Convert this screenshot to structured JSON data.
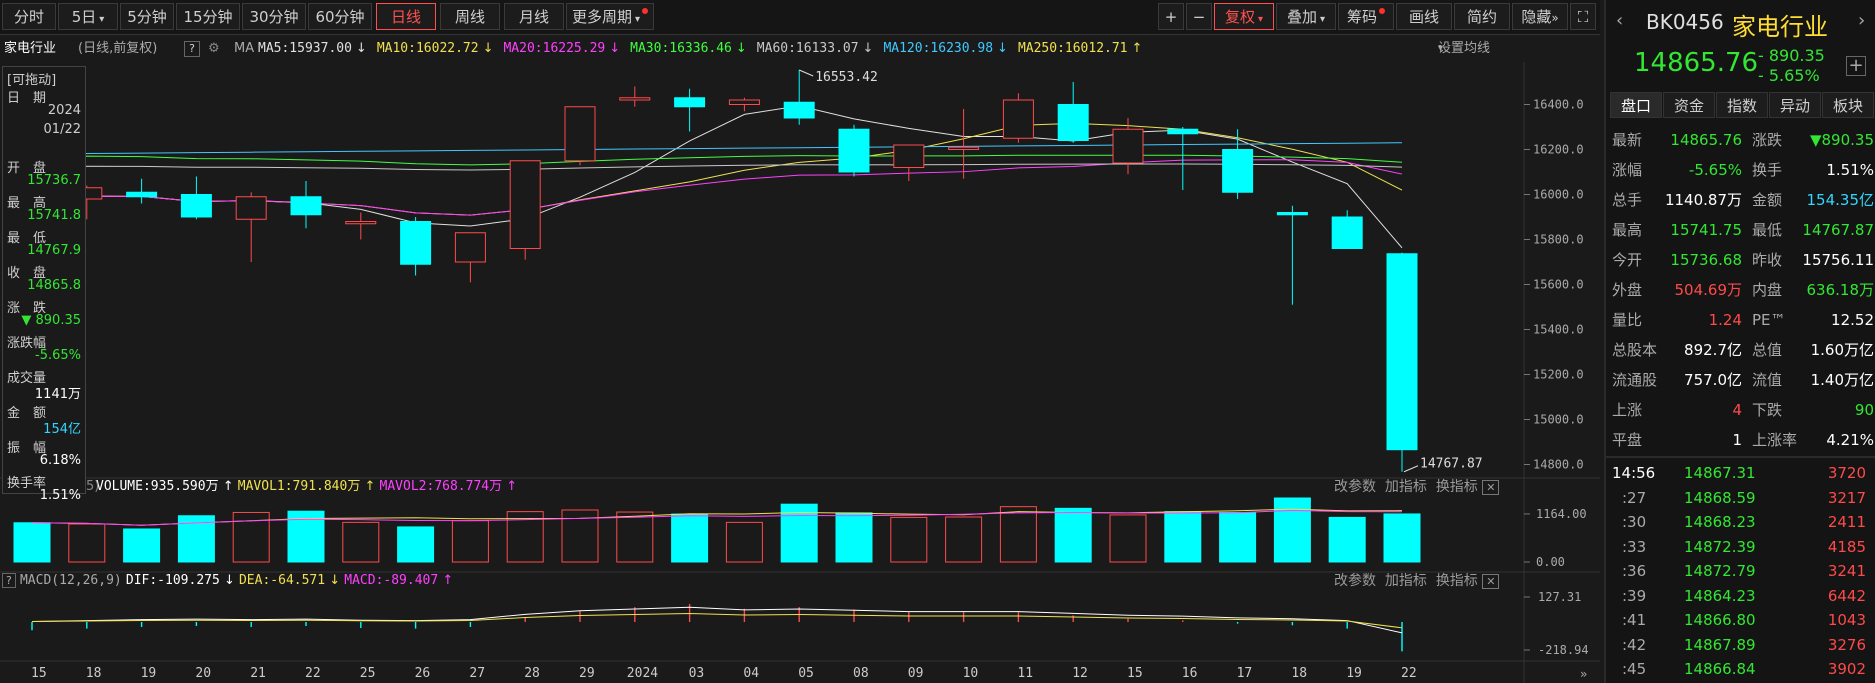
{
  "toolbar": {
    "periods": [
      "分时",
      "5日",
      "5分钟",
      "15分钟",
      "30分钟",
      "60分钟",
      "日线",
      "周线",
      "月线",
      "更多周期"
    ],
    "active_period": "日线",
    "right_buttons": [
      "复权",
      "叠加",
      "筹码",
      "画线",
      "简约",
      "隐藏"
    ],
    "plus": "+",
    "minus": "−",
    "fs": "⛶"
  },
  "ma_line": {
    "name": "家电行业",
    "mode": "(日线,前复权)",
    "q": "?",
    "ma_label": "MA",
    "items": [
      {
        "text": "MA5:15937.00",
        "arrow": "↓",
        "color": "#e0e0e0"
      },
      {
        "text": "MA10:16022.72",
        "arrow": "↓",
        "color": "#f0e050"
      },
      {
        "text": "MA20:16225.29",
        "arrow": "↓",
        "color": "#ff40ff"
      },
      {
        "text": "MA30:16336.46",
        "arrow": "↓",
        "color": "#40ff40"
      },
      {
        "text": "MA60:16133.07",
        "arrow": "↓",
        "color": "#c8c8c8"
      },
      {
        "text": "MA120:16230.98",
        "arrow": "↓",
        "color": "#40c8ff"
      },
      {
        "text": "MA250:16012.71",
        "arrow": "↑",
        "color": "#f0e050"
      }
    ],
    "settings": "设置均线"
  },
  "left_panel": {
    "drag": "[可拖动]",
    "rows": [
      {
        "t": "日　期",
        "v": "2024"
      },
      {
        "t": "",
        "v": "01/22"
      },
      {
        "t": "开　盘",
        "v": "15736.7",
        "c": "green"
      },
      {
        "t": "最　高",
        "v": "15741.8",
        "c": "green"
      },
      {
        "t": "最　低",
        "v": "14767.9",
        "c": "green"
      },
      {
        "t": "收　盘",
        "v": "14865.8",
        "c": "green"
      },
      {
        "t": "涨　跌",
        "v": "▼ 890.35",
        "c": "green"
      },
      {
        "t": "涨跌幅",
        "v": "-5.65%",
        "c": "green"
      },
      {
        "t": "成交量",
        "v": "1141万",
        "c": "white"
      },
      {
        "t": "金　额",
        "v": "154亿",
        "c": "cyan"
      },
      {
        "t": "振　幅",
        "v": "6.18%",
        "c": "white"
      },
      {
        "t": "换手率",
        "v": "1.51%",
        "c": "white"
      }
    ]
  },
  "chart_data": {
    "type": "candlestick",
    "dates": [
      "15",
      "18",
      "19",
      "20",
      "21",
      "22",
      "25",
      "26",
      "27",
      "28",
      "29",
      "2024",
      "03",
      "04",
      "05",
      "08",
      "09",
      "10",
      "11",
      "12",
      "15",
      "16",
      "17",
      "18",
      "19",
      "22"
    ],
    "candles": [
      {
        "o": 16050,
        "h": 16080,
        "l": 15930,
        "c": 15955
      },
      {
        "o": 15980,
        "h": 16040,
        "l": 15890,
        "c": 16030
      },
      {
        "o": 16010,
        "h": 16070,
        "l": 15960,
        "c": 15990
      },
      {
        "o": 16000,
        "h": 16080,
        "l": 15890,
        "c": 15900
      },
      {
        "o": 15890,
        "h": 16010,
        "l": 15700,
        "c": 15990
      },
      {
        "o": 15990,
        "h": 16060,
        "l": 15850,
        "c": 15910
      },
      {
        "o": 15870,
        "h": 15920,
        "l": 15800,
        "c": 15880
      },
      {
        "o": 15880,
        "h": 15900,
        "l": 15640,
        "c": 15690
      },
      {
        "o": 15700,
        "h": 15830,
        "l": 15610,
        "c": 15830
      },
      {
        "o": 15760,
        "h": 16120,
        "l": 15710,
        "c": 16150
      },
      {
        "o": 16150,
        "h": 16390,
        "l": 16130,
        "c": 16390
      },
      {
        "o": 16420,
        "h": 16480,
        "l": 16390,
        "c": 16430
      },
      {
        "o": 16430,
        "h": 16470,
        "l": 16280,
        "c": 16390
      },
      {
        "o": 16400,
        "h": 16430,
        "l": 16370,
        "c": 16420
      },
      {
        "o": 16410,
        "h": 16553.42,
        "l": 16310,
        "c": 16340
      },
      {
        "o": 16290,
        "h": 16310,
        "l": 16080,
        "c": 16100
      },
      {
        "o": 16120,
        "h": 16220,
        "l": 16060,
        "c": 16220
      },
      {
        "o": 16200,
        "h": 16380,
        "l": 16070,
        "c": 16210
      },
      {
        "o": 16250,
        "h": 16450,
        "l": 16230,
        "c": 16420
      },
      {
        "o": 16400,
        "h": 16500,
        "l": 16230,
        "c": 16240
      },
      {
        "o": 16140,
        "h": 16340,
        "l": 16090,
        "c": 16290
      },
      {
        "o": 16290,
        "h": 16300,
        "l": 16020,
        "c": 16270
      },
      {
        "o": 16200,
        "h": 16290,
        "l": 15980,
        "c": 16010
      },
      {
        "o": 15920,
        "h": 15950,
        "l": 15510,
        "c": 15910
      },
      {
        "o": 15900,
        "h": 15930,
        "l": 15760,
        "c": 15760
      },
      {
        "o": 15736.68,
        "h": 15741.75,
        "l": 14767.87,
        "c": 14865.76
      }
    ],
    "max_label": "16553.42",
    "min_label": "14767.87",
    "price_ticks": [
      "16400.0",
      "16200.0",
      "16000.0",
      "15800.0",
      "15600.0",
      "15400.0",
      "15200.0",
      "15000.0",
      "14800.0"
    ],
    "ylim": [
      14740,
      16580
    ],
    "volume": [
      950,
      920,
      800,
      1120,
      1200,
      1230,
      960,
      850,
      1000,
      1220,
      1260,
      1210,
      1160,
      960,
      1400,
      1190,
      1080,
      1090,
      1340,
      1300,
      1140,
      1220,
      1200,
      1550,
      1080,
      1164
    ],
    "volume_ticks": [
      "1164.00",
      "0.00"
    ],
    "volume_header": {
      "q": "5)",
      "vol": "VOLUME:935.590万",
      "vol_arrow": "↑",
      "m1": "MAVOL1:791.840万",
      "m1_arrow": "↑",
      "m2": "MAVOL2:768.774万",
      "m2_arrow": "↑"
    },
    "macd_ticks": [
      "127.31",
      "-218.94"
    ],
    "macd_header": {
      "q": "?",
      "name": "MACD(12,26,9)",
      "dif": "DIF:-109.275",
      "dif_arrow": "↓",
      "dea": "DEA:-64.571",
      "dea_arrow": "↓",
      "macd": "MACD:-89.407",
      "macd_arrow": "↑"
    },
    "macd_bars": [
      -25,
      -20,
      -15,
      -12,
      -15,
      -12,
      -18,
      -20,
      -15,
      15,
      35,
      45,
      55,
      40,
      45,
      38,
      30,
      30,
      30,
      20,
      10,
      5,
      -5,
      -10,
      -20,
      -89
    ],
    "sub_buttons": [
      "改参数",
      "加指标",
      "换指标"
    ],
    "colors": {
      "up": "#ff4a4a",
      "down": "#00ffff",
      "ma5": "#e0e0e0",
      "ma10": "#f0e050",
      "ma20": "#ff40ff",
      "ma30": "#40ff40",
      "ma60": "#c8c8c8",
      "ma120": "#40c8ff"
    }
  },
  "right_panel": {
    "code": "BK0456",
    "name": "家电行业",
    "price": "14865.76",
    "change": "- 890.35",
    "change_pct": "- 5.65%",
    "tabs": [
      "盘口",
      "资金",
      "指数",
      "异动",
      "板块"
    ],
    "quote_rows": [
      [
        {
          "t": "最新"
        },
        {
          "v": "14865.76",
          "c": "green"
        },
        {
          "t": "涨跌"
        },
        {
          "v": "▼890.35",
          "c": "green"
        }
      ],
      [
        {
          "t": "涨幅"
        },
        {
          "v": "-5.65%",
          "c": "green"
        },
        {
          "t": "换手"
        },
        {
          "v": "1.51%",
          "c": "white"
        }
      ],
      [
        {
          "t": "总手"
        },
        {
          "v": "1140.87万",
          "c": "white"
        },
        {
          "t": "金额"
        },
        {
          "v": "154.35亿",
          "c": "cyan"
        }
      ],
      [
        {
          "t": "最高"
        },
        {
          "v": "15741.75",
          "c": "green"
        },
        {
          "t": "最低"
        },
        {
          "v": "14767.87",
          "c": "green"
        }
      ],
      [
        {
          "t": "今开"
        },
        {
          "v": "15736.68",
          "c": "green"
        },
        {
          "t": "昨收"
        },
        {
          "v": "15756.11",
          "c": "white"
        }
      ],
      [
        {
          "t": "外盘"
        },
        {
          "v": "504.69万",
          "c": "red"
        },
        {
          "t": "内盘"
        },
        {
          "v": "636.18万",
          "c": "green"
        }
      ],
      [
        {
          "t": "量比"
        },
        {
          "v": "1.24",
          "c": "red"
        },
        {
          "t": "PE™"
        },
        {
          "v": "12.52",
          "c": "white"
        }
      ],
      [
        {
          "t": "总股本"
        },
        {
          "v": "892.7亿",
          "c": "white"
        },
        {
          "t": "总值"
        },
        {
          "v": "1.60万亿",
          "c": "white"
        }
      ],
      [
        {
          "t": "流通股"
        },
        {
          "v": "757.0亿",
          "c": "white"
        },
        {
          "t": "流值"
        },
        {
          "v": "1.40万亿",
          "c": "white"
        }
      ],
      [
        {
          "t": "上涨"
        },
        {
          "v": "4",
          "c": "red"
        },
        {
          "t": "下跌"
        },
        {
          "v": "90",
          "c": "green"
        }
      ],
      [
        {
          "t": "平盘"
        },
        {
          "v": "1",
          "c": "white"
        },
        {
          "t": "上涨率"
        },
        {
          "v": "4.21%",
          "c": "white"
        }
      ]
    ],
    "ticks": [
      {
        "time": "14:56",
        "price": "14867.31",
        "vol": "3720"
      },
      {
        "time": ":27",
        "price": "14868.59",
        "vol": "3217"
      },
      {
        "time": ":30",
        "price": "14868.23",
        "vol": "2411"
      },
      {
        "time": ":33",
        "price": "14872.39",
        "vol": "4185"
      },
      {
        "time": ":36",
        "price": "14872.79",
        "vol": "3241"
      },
      {
        "time": ":39",
        "price": "14864.23",
        "vol": "6442"
      },
      {
        "time": ":41",
        "price": "14866.80",
        "vol": "1043"
      },
      {
        "time": ":42",
        "price": "14867.89",
        "vol": "3276"
      },
      {
        "time": ":45",
        "price": "14866.84",
        "vol": "3902"
      }
    ]
  }
}
